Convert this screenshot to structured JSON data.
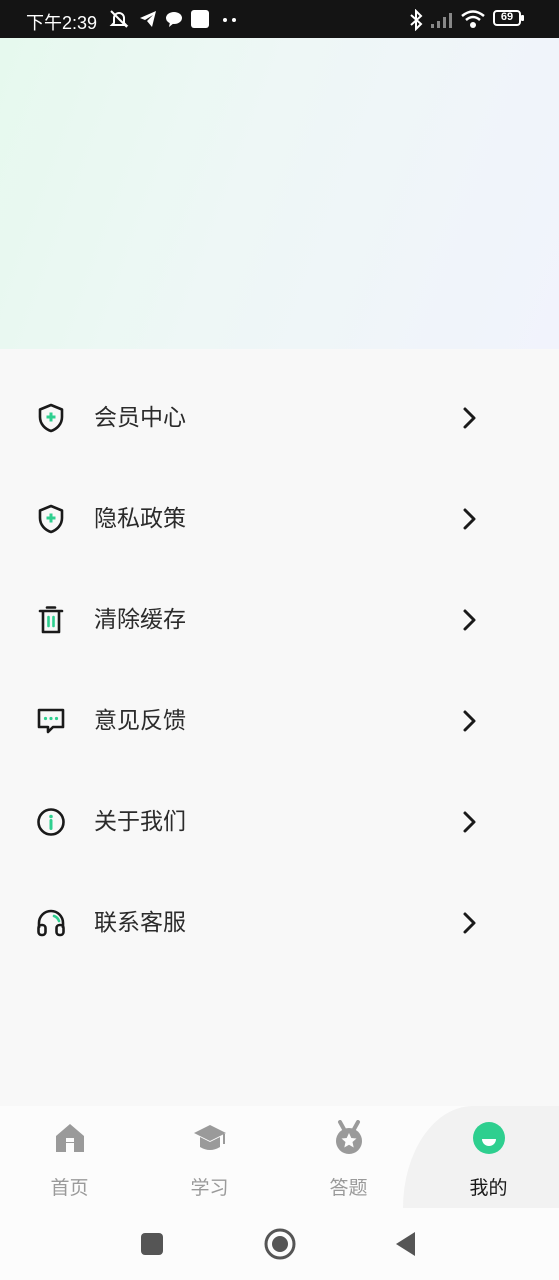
{
  "status_bar": {
    "time": "下午2:39",
    "battery": "69"
  },
  "menu": {
    "items": [
      {
        "label": "会员中心",
        "icon": "shield-plus-icon"
      },
      {
        "label": "隐私政策",
        "icon": "shield-plus-icon"
      },
      {
        "label": "清除缓存",
        "icon": "trash-icon"
      },
      {
        "label": "意见反馈",
        "icon": "chat-bubble-icon"
      },
      {
        "label": "关于我们",
        "icon": "info-icon"
      },
      {
        "label": "联系客服",
        "icon": "headset-icon"
      }
    ]
  },
  "tabbar": {
    "tabs": [
      {
        "label": "首页",
        "icon": "home-icon"
      },
      {
        "label": "学习",
        "icon": "graduation-cap-icon"
      },
      {
        "label": "答题",
        "icon": "medal-icon"
      },
      {
        "label": "我的",
        "icon": "smile-icon"
      }
    ],
    "active": "我的"
  },
  "colors": {
    "accent": "#2ecf8f",
    "status_bar": "#141414",
    "text": "#2b2b2b"
  }
}
